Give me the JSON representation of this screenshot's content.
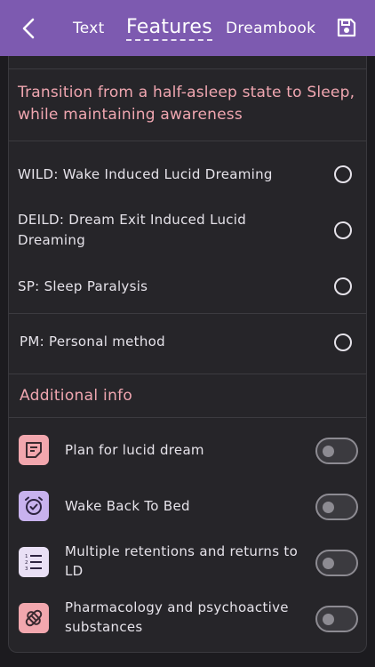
{
  "header": {
    "back_icon": "chevron-left-icon",
    "tabs": [
      {
        "label": "Text"
      },
      {
        "label": "Features"
      },
      {
        "label": "Dreambook"
      }
    ],
    "active_tab": "Features",
    "save_icon": "floppy-disk-icon",
    "accent_color": "#7d5ab0"
  },
  "main": {
    "heading": "Transition from a half-asleep state to Sleep, while maintaining awareness",
    "options": [
      {
        "label": "WILD: Wake Induced Lucid Dreaming",
        "selected": false
      },
      {
        "label": "DEILD: Dream Exit Induced Lucid Dreaming",
        "selected": false
      },
      {
        "label": "SP: Sleep Paralysis",
        "selected": false
      },
      {
        "label": "PM: Personal method",
        "selected": false
      }
    ],
    "additional_title": "Additional info",
    "features": [
      {
        "label": "Plan for lucid dream",
        "icon": "note-icon",
        "icon_bg": "#f2a7ae",
        "enabled": false
      },
      {
        "label": "Wake Back To Bed",
        "icon": "alarm-clock-icon",
        "icon_bg": "#c8b2ee",
        "enabled": false
      },
      {
        "label": "Multiple retentions and returns to LD",
        "icon": "numbered-list-icon",
        "icon_bg": "#e9e0f5",
        "enabled": false
      },
      {
        "label": "Pharmacology and psychoactive substances",
        "icon": "pills-icon",
        "icon_bg": "#f2a7ae",
        "enabled": false
      }
    ]
  }
}
